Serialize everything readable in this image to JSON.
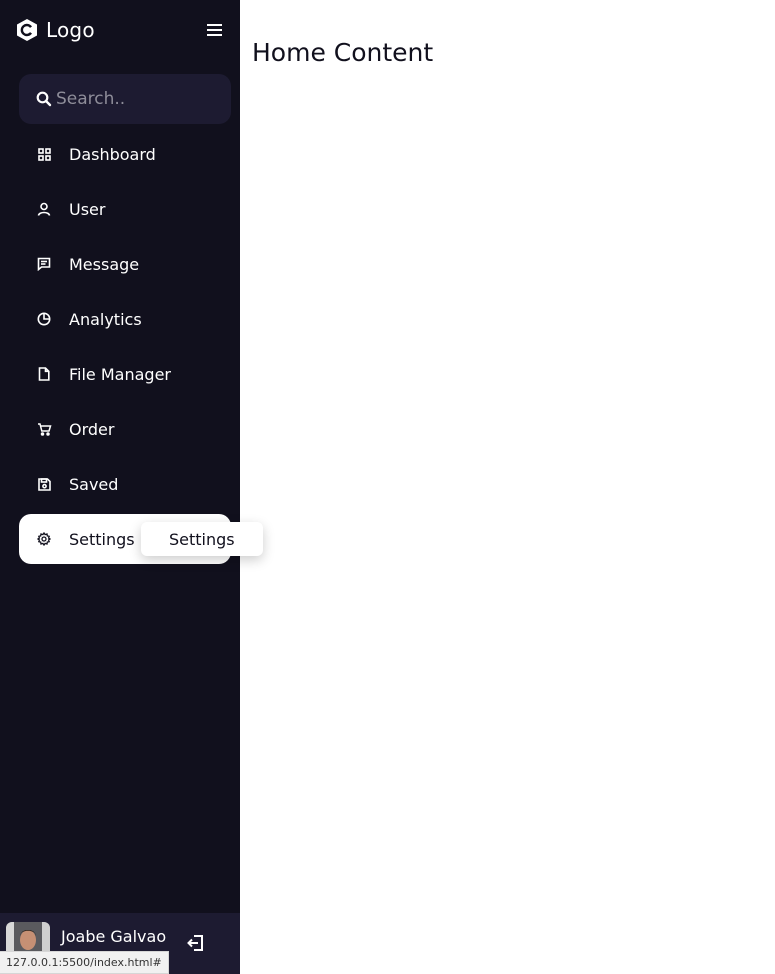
{
  "sidebar": {
    "logo_text": "Logo",
    "logo_icon": "hexagon-logo-icon",
    "menu_icon": "hamburger-menu-icon",
    "search": {
      "placeholder": "Search..",
      "value": ""
    },
    "items": [
      {
        "label": "Dashboard",
        "icon": "grid-icon"
      },
      {
        "label": "User",
        "icon": "user-icon"
      },
      {
        "label": "Message",
        "icon": "chat-icon"
      },
      {
        "label": "Analytics",
        "icon": "pie-chart-icon"
      },
      {
        "label": "File Manager",
        "icon": "file-icon"
      },
      {
        "label": "Order",
        "icon": "cart-icon"
      },
      {
        "label": "Saved",
        "icon": "save-icon"
      },
      {
        "label": "Settings",
        "icon": "gear-icon",
        "active": true
      }
    ],
    "tooltip": "Settings",
    "profile": {
      "name": "Joabe Galvao",
      "logout_icon": "logout-icon"
    }
  },
  "main": {
    "title": "Home Content"
  },
  "status_bar": {
    "url": "127.0.0.1:5500/index.html#"
  },
  "colors": {
    "sidebar_bg": "#11101d",
    "search_bg": "#1d1b31",
    "active_bg": "#ffffff"
  }
}
